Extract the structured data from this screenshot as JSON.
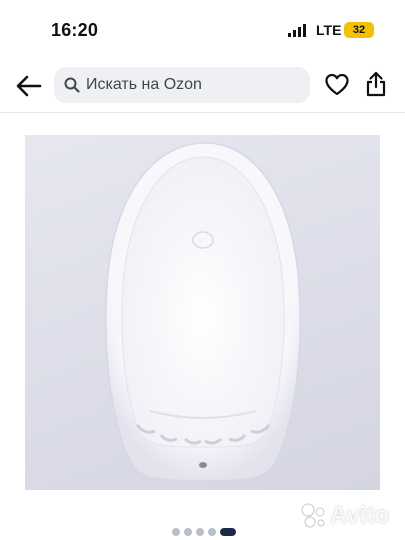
{
  "status_bar": {
    "time": "16:20",
    "network": "LTE",
    "battery": "32"
  },
  "nav": {
    "search_placeholder": "Искать на Ozon"
  },
  "gallery": {
    "photo_count": 5,
    "active_index": 4
  },
  "watermark": "Avito",
  "colors": {
    "accent": "#f2c200",
    "active_dot": "#1b2a4a",
    "search_bg": "#eef0f4"
  },
  "icons": [
    "back-arrow-icon",
    "search-icon",
    "heart-icon",
    "share-icon"
  ]
}
